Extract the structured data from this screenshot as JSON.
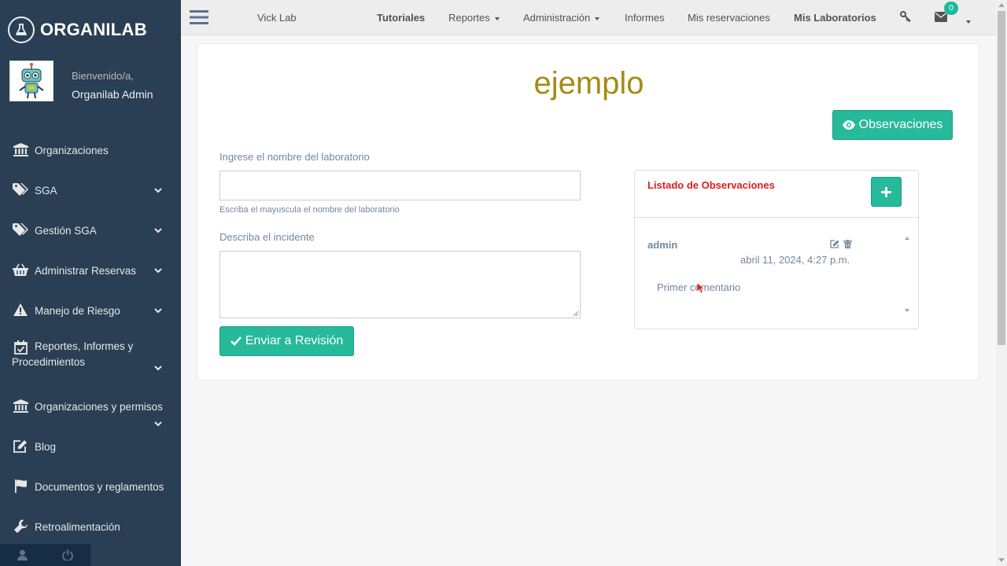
{
  "brand": {
    "name": "ORGANILAB"
  },
  "profile": {
    "welcome": "Bienvenido/a,",
    "username": "Organilab Admin"
  },
  "sidebar": {
    "items": [
      {
        "label": "Organizaciones",
        "icon": "bank-icon",
        "expandable": false
      },
      {
        "label": "SGA",
        "icon": "tags-icon",
        "expandable": true
      },
      {
        "label": "Gestión SGA",
        "icon": "tags-icon",
        "expandable": true
      },
      {
        "label": "Administrar Reservas",
        "icon": "basket-icon",
        "expandable": true
      },
      {
        "label": "Manejo de Riesgo",
        "icon": "warning-icon",
        "expandable": true
      },
      {
        "label": "Reportes, Informes y Procedimientos",
        "icon": "calendar-check-icon",
        "expandable": true
      },
      {
        "label": "Organizaciones y permisos",
        "icon": "bank-icon",
        "expandable": true
      },
      {
        "label": "Blog",
        "icon": "edit-icon",
        "expandable": false
      },
      {
        "label": "Documentos y reglamentos",
        "icon": "flag-icon",
        "expandable": false
      },
      {
        "label": "Retroalimentación",
        "icon": "wrench-icon",
        "expandable": false
      }
    ]
  },
  "topnav": {
    "lab": "Vick Lab",
    "tutoriales": "Tutoriales",
    "reportes": "Reportes",
    "administracion": "Administración",
    "informes": "Informes",
    "mis_reservaciones": "Mis reservaciones",
    "mis_laboratorios": "Mis Laboratorios",
    "notification_count": "0"
  },
  "main": {
    "title": "ejemplo",
    "observations_button": "Observaciones",
    "lab_name_label": "Ingrese el nombre del laboratorio",
    "lab_name_value": "",
    "lab_name_help": "Escriba el mayuscula el nombre del laboratorio",
    "incident_label": "Describa el incidente",
    "incident_value": "",
    "submit_button": "Enviar a Revisión"
  },
  "observations": {
    "title": "Listado de Observaciones",
    "items": [
      {
        "author": "admin",
        "date": "abril 11, 2024, 4:27 p.m.",
        "comment": "Primer comentario"
      }
    ]
  },
  "colors": {
    "sidebar": "#2a3f54",
    "accent_green": "#26b99a",
    "title_gold": "#a68a14",
    "observations_title": "#e01b1b"
  }
}
